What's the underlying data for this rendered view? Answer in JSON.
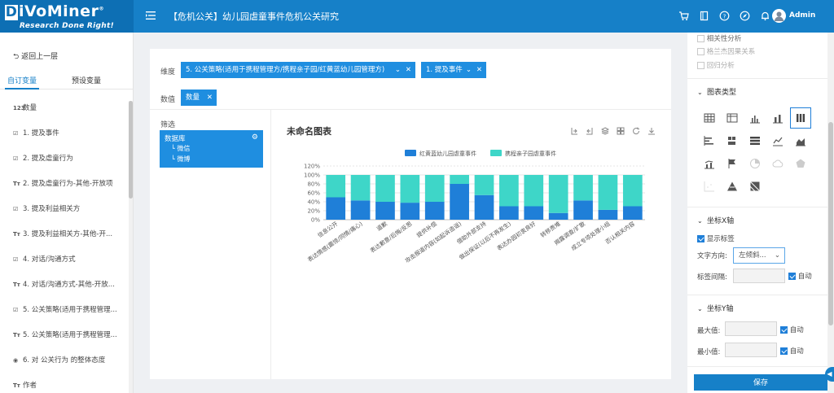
{
  "header": {
    "logo_text": "DiVoMiner",
    "logo_slogan": "Research Done Right!",
    "title": "【危机公关】幼儿园虐童事件危机公关研究",
    "user": "Admin"
  },
  "sidebar": {
    "back_label": "返回上一层",
    "tabs": [
      "自订变量",
      "预设变量"
    ],
    "items": [
      {
        "icon": "123",
        "label": "数量"
      },
      {
        "icon": "☑",
        "label": "1. 提及事件"
      },
      {
        "icon": "☑",
        "label": "2. 提及虐童行为"
      },
      {
        "icon": "Tт",
        "label": "2. 提及虐童行为-其他-开放项"
      },
      {
        "icon": "☑",
        "label": "3. 提及利益相关方"
      },
      {
        "icon": "Tт",
        "label": "3. 提及利益相关方-其他-开..."
      },
      {
        "icon": "☑",
        "label": "4. 对话/沟通方式"
      },
      {
        "icon": "Tт",
        "label": "4. 对话/沟通方式-其他-开放..."
      },
      {
        "icon": "☑",
        "label": "5. 公关策略(适用于携程管理..."
      },
      {
        "icon": "Tт",
        "label": "5. 公关策略(适用于携程管理..."
      },
      {
        "icon": "◉",
        "label": "6. 对 公关行为 的整体态度"
      },
      {
        "icon": "Tт",
        "label": "作者"
      }
    ]
  },
  "main": {
    "dimension_label": "维度",
    "dim_tags": [
      "5. 公关策略(适用于携程管理方/携程亲子园/红黄蓝幼儿园管理方)",
      "1. 提及事件"
    ],
    "value_label": "数值",
    "value_tag": "数量",
    "filter_label": "筛选",
    "filter_db": "数据库",
    "filter_children": [
      "微信",
      "微博"
    ]
  },
  "chart_data": {
    "type": "bar",
    "stacked": true,
    "title": "未命名图表",
    "legend_position": "top",
    "series": [
      {
        "name": "红黄蓝幼儿园虐童事件",
        "color": "#1f7fd8",
        "values": [
          50,
          43,
          40,
          38,
          40,
          80,
          55,
          30,
          30,
          15,
          43,
          22,
          30
        ]
      },
      {
        "name": "携程亲子园虐童事件",
        "color": "#3ed6c8",
        "values": [
          50,
          57,
          60,
          62,
          60,
          20,
          45,
          70,
          70,
          85,
          57,
          78,
          70
        ]
      }
    ],
    "categories": [
      "信息公开",
      "表达情感(震惊/同情/痛心)",
      "道歉",
      "表达歉意/后悔/反思",
      "提供补偿",
      "攻击报道内容(如起诉造谣)",
      "借助外部支持",
      "做出保证(以后不再发生)",
      "表达办园初衷良好",
      "转移责难",
      "揭露调查/扩散",
      "成立专项处理小组",
      "否认相关内容"
    ],
    "y_ticks": [
      "0%",
      "20%",
      "40%",
      "60%",
      "80%",
      "100%",
      "120%"
    ],
    "ylim": [
      0,
      120
    ]
  },
  "right_panel": {
    "analysis": [
      {
        "label": "相关性分析",
        "disabled": false
      },
      {
        "label": "格兰杰因果关系",
        "disabled": true
      },
      {
        "label": "回归分析",
        "disabled": true
      }
    ],
    "chart_type_title": "图表类型",
    "x_axis_title": "坐标X轴",
    "show_labels": "显示标签",
    "text_direction_label": "文字方向:",
    "text_direction_value": "左倾斜...",
    "label_interval_label": "标签间隔:",
    "auto_label": "自动",
    "y_axis_title": "坐标Y轴",
    "max_label": "最大值:",
    "min_label": "最小值:",
    "save_label": "保存"
  }
}
